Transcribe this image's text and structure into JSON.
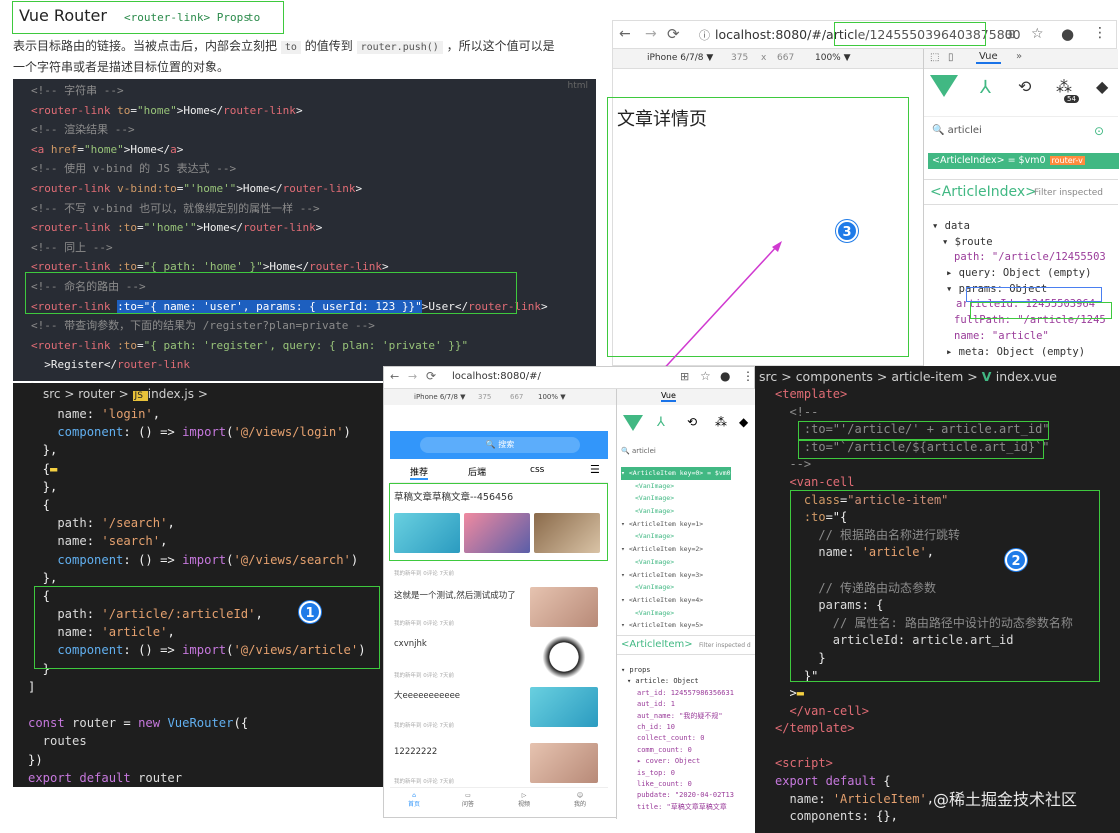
{
  "doc": {
    "title": "Vue Router",
    "tag": "<router-link> Props",
    "to": "to",
    "desc_line1": "表示目标路由的链接。当被点击后，内部会立刻把",
    "desc_code1": "to",
    "desc_mid": "的值传到",
    "desc_code2": "router.push()",
    "desc_end": "，所以这个值可以是",
    "desc_line2": "一个字符串或者是描述目标位置的对象。",
    "html_label": "html"
  },
  "code1": [
    {
      "cls": "cm",
      "t": "<!-- 字符串 -->"
    },
    {
      "seg": [
        [
          "tg",
          "<router-link "
        ],
        [
          "at",
          "to"
        ],
        [
          "tx",
          "="
        ],
        [
          "st",
          "\"home\""
        ],
        [
          "tx",
          ">Home</"
        ],
        [
          "tg",
          "router-link"
        ],
        [
          "tx",
          ">"
        ]
      ]
    },
    {
      "cls": "cm",
      "t": "<!-- 渲染结果 -->"
    },
    {
      "seg": [
        [
          "tg",
          "<a "
        ],
        [
          "at",
          "href"
        ],
        [
          "tx",
          "="
        ],
        [
          "st",
          "\"home\""
        ],
        [
          "tx",
          ">Home</"
        ],
        [
          "tg",
          "a"
        ],
        [
          "tx",
          ">"
        ]
      ]
    },
    {
      "cls": "cm",
      "t": "<!-- 使用 v-bind 的 JS 表达式 -->"
    },
    {
      "seg": [
        [
          "tg",
          "<router-link "
        ],
        [
          "at",
          "v-bind:to"
        ],
        [
          "tx",
          "="
        ],
        [
          "st",
          "\"'home'\""
        ],
        [
          "tx",
          ">Home</"
        ],
        [
          "tg",
          "router-link"
        ],
        [
          "tx",
          ">"
        ]
      ]
    },
    {
      "cls": "cm",
      "t": "<!-- 不写 v-bind 也可以，就像绑定别的属性一样 -->"
    },
    {
      "seg": [
        [
          "tg",
          "<router-link "
        ],
        [
          "at",
          ":to"
        ],
        [
          "tx",
          "="
        ],
        [
          "st",
          "\"'home'\""
        ],
        [
          "tx",
          ">Home</"
        ],
        [
          "tg",
          "router-link"
        ],
        [
          "tx",
          ">"
        ]
      ]
    },
    {
      "cls": "cm",
      "t": "<!-- 同上 -->"
    },
    {
      "seg": [
        [
          "tg",
          "<router-link "
        ],
        [
          "at",
          ":to"
        ],
        [
          "tx",
          "="
        ],
        [
          "st",
          "\"{ path: 'home' }\""
        ],
        [
          "tx",
          ">Home</"
        ],
        [
          "tg",
          "router-link"
        ],
        [
          "tx",
          ">"
        ]
      ]
    },
    {
      "cls": "cm",
      "t": "<!-- 命名的路由 -->"
    },
    {
      "seg": [
        [
          "tg",
          "<router-link "
        ],
        [
          "hl",
          ":to=\"{ name: 'user', params: { userId: 123 }}\""
        ],
        [
          "tx",
          ">User</"
        ],
        [
          "tg",
          "router-link"
        ],
        [
          "tx",
          ">"
        ]
      ]
    },
    {
      "cls": "cm",
      "t": "<!-- 带查询参数，下面的结果为 /register?plan=private -->"
    },
    {
      "seg": [
        [
          "tg",
          "<router-link "
        ],
        [
          "at",
          ":to"
        ],
        [
          "tx",
          "="
        ],
        [
          "st",
          "\"{ path: 'register', query: { plan: 'private' }}\""
        ]
      ]
    },
    {
      "seg": [
        [
          "tx",
          "  >Register</"
        ],
        [
          "tg",
          "router-link"
        ]
      ]
    },
    {
      "seg": [
        [
          "tx",
          ">"
        ]
      ]
    }
  ],
  "code2": {
    "crumb": [
      "src",
      ">",
      "router",
      ">",
      "JS",
      "index.js",
      ">"
    ],
    "lines": [
      {
        "seg": [
          [
            "pr",
            "    name"
          ],
          [
            "tx",
            ": "
          ],
          [
            "st2",
            "'login'"
          ],
          [
            "tx",
            ","
          ]
        ]
      },
      {
        "seg": [
          [
            "fn",
            "    component"
          ],
          [
            "tx",
            ": () => "
          ],
          [
            "kw",
            "import"
          ],
          [
            "tx",
            "("
          ],
          [
            "st2",
            "'@/views/login'"
          ],
          [
            "tx",
            ")"
          ]
        ]
      },
      {
        "seg": [
          [
            "tx",
            "  },"
          ]
        ]
      },
      {
        "seg": [
          [
            "tx",
            "  {"
          ],
          [
            "yl",
            "▬"
          ]
        ]
      },
      {
        "seg": [
          [
            "tx",
            "  },"
          ]
        ]
      },
      {
        "seg": [
          [
            "tx",
            "  {"
          ]
        ]
      },
      {
        "seg": [
          [
            "pr",
            "    path"
          ],
          [
            "tx",
            ": "
          ],
          [
            "st2",
            "'/search'"
          ],
          [
            "tx",
            ","
          ]
        ]
      },
      {
        "seg": [
          [
            "pr",
            "    name"
          ],
          [
            "tx",
            ": "
          ],
          [
            "st2",
            "'search'"
          ],
          [
            "tx",
            ","
          ]
        ]
      },
      {
        "seg": [
          [
            "fn",
            "    component"
          ],
          [
            "tx",
            ": () => "
          ],
          [
            "kw",
            "import"
          ],
          [
            "tx",
            "("
          ],
          [
            "st2",
            "'@/views/search'"
          ],
          [
            "tx",
            ")"
          ]
        ]
      },
      {
        "seg": [
          [
            "tx",
            "  },"
          ]
        ]
      },
      {
        "seg": [
          [
            "tx",
            "  {"
          ]
        ]
      },
      {
        "seg": [
          [
            "pr",
            "    path"
          ],
          [
            "tx",
            ": "
          ],
          [
            "st2",
            "'/article/:articleId'"
          ],
          [
            "tx",
            ","
          ]
        ]
      },
      {
        "seg": [
          [
            "pr",
            "    name"
          ],
          [
            "tx",
            ": "
          ],
          [
            "st2",
            "'article'"
          ],
          [
            "tx",
            ","
          ]
        ]
      },
      {
        "seg": [
          [
            "fn",
            "    component"
          ],
          [
            "tx",
            ": () => "
          ],
          [
            "kw",
            "import"
          ],
          [
            "tx",
            "("
          ],
          [
            "st2",
            "'@/views/article'"
          ],
          [
            "tx",
            ")"
          ]
        ]
      },
      {
        "seg": [
          [
            "tx",
            "  }"
          ]
        ]
      },
      {
        "seg": [
          [
            "tx",
            "]"
          ]
        ]
      },
      {
        "seg": [
          [
            "tx",
            ""
          ]
        ]
      },
      {
        "seg": [
          [
            "kw",
            "const "
          ],
          [
            "pr",
            "router"
          ],
          [
            "tx",
            " = "
          ],
          [
            "kw",
            "new "
          ],
          [
            "fn",
            "VueRouter"
          ],
          [
            "tx",
            "({"
          ]
        ]
      },
      {
        "seg": [
          [
            "pr",
            "  routes"
          ]
        ]
      },
      {
        "seg": [
          [
            "tx",
            "})"
          ]
        ]
      },
      {
        "seg": [
          [
            "kw",
            "export default "
          ],
          [
            "pr",
            "router"
          ]
        ]
      }
    ]
  },
  "browser1": {
    "url": "localhost:8080/#/article/1245550396403875800",
    "url_prefix": "localhost:8080/#/articl",
    "url_hl": "e/1245550396403875800",
    "device": "iPhone 6/7/8 ▼",
    "w": "375",
    "x": "x",
    "h": "667",
    "zoom": "100% ▼",
    "page_title": "文章详情页",
    "vue_tab": "Vue",
    "more": "»",
    "count": "54",
    "search": "articlei",
    "comp": "<ArticleIndex> = $vm0",
    "router_tag": "router-v",
    "inspect_comp": "<ArticleIndex>",
    "filter": "Filter inspected",
    "tree": [
      "▾ data",
      "▾ $route",
      "path: \"/article/12455503",
      "▸ query: Object (empty)",
      "▾ params: Object",
      "articleId: 12455503964",
      "fullPath: \"/article/1245",
      "name: \"article\"",
      "▸ meta: Object (empty)"
    ]
  },
  "browser2": {
    "url": "localhost:8080/#/",
    "device": "iPhone 6/7/8 ▼",
    "w": "375",
    "h": "667",
    "zoom": "100% ▼",
    "vue_tab": "Vue",
    "search_btn": "🔍 搜索",
    "tabs": [
      "推荐",
      "后端",
      "css",
      ""
    ],
    "items": [
      {
        "title": "草稿文章草稿文章--456456",
        "meta": "我的新年到  0评论  7天前"
      },
      {
        "title": "这就是一个测试,然后测试成功了",
        "meta": "我的新年到  0评论  7天前"
      },
      {
        "title": "cxvnjhk",
        "meta": "我的新年到  0评论  7天前"
      },
      {
        "title": "大eeeeeeeeeee",
        "meta": "我的新年到  0评论  7天前"
      },
      {
        "title": "12222222",
        "meta": "我的新年到  0评论  7天前"
      }
    ],
    "bottom_nav": [
      "首页",
      "问答",
      "视频",
      "我的"
    ],
    "search": "articlei",
    "tree_items": [
      "▾ <ArticleItem key=0> = $vm0",
      "<VanImage>",
      "<VanImage>",
      "<VanImage>",
      "▾ <ArticleItem key=1>",
      "<VanImage>",
      "▾ <ArticleItem key=2>",
      "<VanImage>",
      "▾ <ArticleItem key=3>",
      "<VanImage>",
      "▾ <ArticleItem key=4>",
      "<VanImage>",
      "▾ <ArticleItem key=5>"
    ],
    "comp": "<ArticleItem>",
    "filter": "Filter inspected d",
    "props": [
      "▾ props",
      "▾ article: Object",
      "art_id: 124557986356631",
      "aut_id: 1",
      "aut_name: \"我的疑不规\"",
      "ch_id: 10",
      "collect_count: 0",
      "comm_count: 0",
      "▸ cover: Object",
      "is_top: 0",
      "like_count: 0",
      "pubdate: \"2020-04-02T13",
      "title: \"草稿文章草稿文章"
    ]
  },
  "code3": {
    "crumb": [
      "src",
      ">",
      "components",
      ">",
      "article-item",
      ">",
      "V",
      "index.vue"
    ],
    "lines": [
      {
        "seg": [
          [
            "tg",
            "<template>"
          ]
        ]
      },
      {
        "seg": [
          [
            "cm",
            "  <!--"
          ]
        ]
      },
      {
        "seg": [
          [
            "cm",
            "    :to=\"'/article/' + article.art_id\""
          ]
        ]
      },
      {
        "seg": [
          [
            "cm",
            "    :to=\"`/article/${article.art_id}`\""
          ]
        ]
      },
      {
        "seg": [
          [
            "cm",
            "  -->"
          ]
        ]
      },
      {
        "seg": [
          [
            "tg",
            "  <van-cell"
          ]
        ]
      },
      {
        "seg": [
          [
            "at",
            "    class"
          ],
          [
            "tx",
            "="
          ],
          [
            "vg",
            "\"article-item\""
          ]
        ]
      },
      {
        "seg": [
          [
            "at",
            "    :to"
          ],
          [
            "tx",
            "=\"{"
          ]
        ]
      },
      {
        "seg": [
          [
            "cm",
            "      // 根据路由名称进行跳转"
          ]
        ]
      },
      {
        "seg": [
          [
            "pr",
            "      name"
          ],
          [
            "tx",
            ": "
          ],
          [
            "st2",
            "'article'"
          ],
          [
            "tx",
            ","
          ]
        ]
      },
      {
        "seg": [
          [
            "tx",
            ""
          ]
        ]
      },
      {
        "seg": [
          [
            "cm",
            "      // 传递路由动态参数"
          ]
        ]
      },
      {
        "seg": [
          [
            "pr",
            "      params"
          ],
          [
            "tx",
            ": {"
          ]
        ]
      },
      {
        "seg": [
          [
            "cm",
            "        // 属性名: 路由路径中设计的动态参数名称"
          ]
        ]
      },
      {
        "seg": [
          [
            "pr",
            "        articleId"
          ],
          [
            "tx",
            ": "
          ],
          [
            "pr",
            "article"
          ],
          [
            "tx",
            "."
          ],
          [
            "pr",
            "art_id"
          ]
        ]
      },
      {
        "seg": [
          [
            "tx",
            "      }"
          ]
        ]
      },
      {
        "seg": [
          [
            "tx",
            "    }\""
          ]
        ]
      },
      {
        "seg": [
          [
            "tx",
            "  >"
          ],
          [
            "yl",
            "▬"
          ]
        ]
      },
      {
        "seg": [
          [
            "tg",
            "  </van-cell>"
          ]
        ]
      },
      {
        "seg": [
          [
            "tg",
            "</template>"
          ]
        ]
      },
      {
        "seg": [
          [
            "tx",
            ""
          ]
        ]
      },
      {
        "seg": [
          [
            "tg",
            "<script>"
          ]
        ]
      },
      {
        "seg": [
          [
            "kw",
            "export default "
          ],
          [
            "tx",
            "{"
          ]
        ]
      },
      {
        "seg": [
          [
            "pr",
            "  name"
          ],
          [
            "tx",
            ": "
          ],
          [
            "st2",
            "'ArticleItem'"
          ],
          [
            "tx",
            ","
          ]
        ]
      },
      {
        "seg": [
          [
            "pr",
            "  components"
          ],
          [
            "tx",
            ": {},"
          ]
        ]
      }
    ]
  },
  "badges": [
    "1",
    "2",
    "3"
  ],
  "watermark": "@稀土掘金技术社区",
  "colors": {
    "green": "#3ec93e",
    "blue": "#1f7be8",
    "magenta": "#d03ad0",
    "editor_bg": "#1e1e1e"
  }
}
